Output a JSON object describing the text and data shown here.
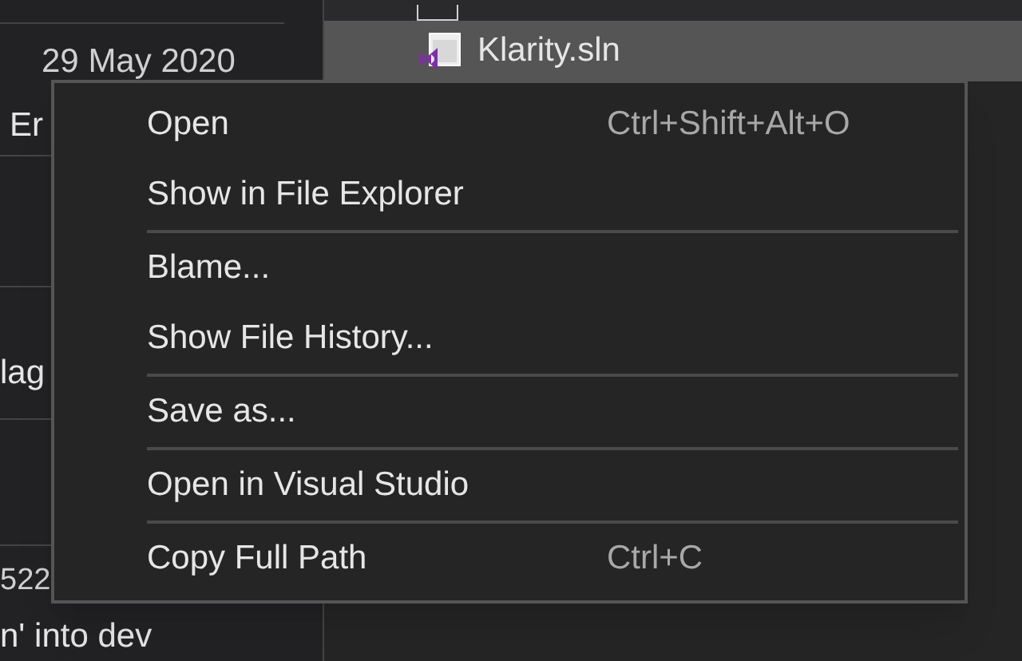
{
  "history": {
    "rows": [
      {
        "date": "29 May 2020"
      },
      {
        "title": "Er"
      },
      {
        "title": "lag"
      },
      {
        "title": "522"
      },
      {
        "title": "n' into dev"
      }
    ]
  },
  "files": {
    "items": [
      {
        "kind": "file",
        "selected": false
      },
      {
        "name": "Klarity.sln",
        "kind": "solution",
        "selected": true
      }
    ]
  },
  "context_menu": {
    "groups": [
      [
        {
          "label": "Open",
          "shortcut": "Ctrl+Shift+Alt+O"
        },
        {
          "label": "Show in File Explorer"
        }
      ],
      [
        {
          "label": "Blame..."
        },
        {
          "label": "Show File History..."
        }
      ],
      [
        {
          "label": "Save as..."
        }
      ],
      [
        {
          "label": "Open in Visual Studio"
        }
      ],
      [
        {
          "label": "Copy Full Path",
          "shortcut": "Ctrl+C"
        }
      ]
    ]
  }
}
